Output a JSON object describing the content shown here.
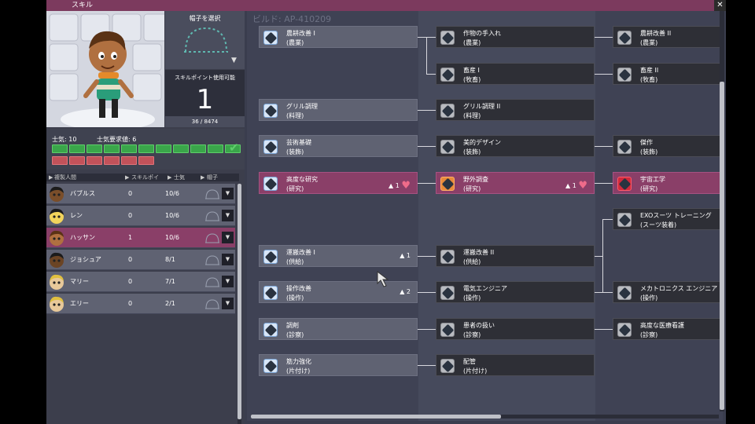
{
  "window": {
    "title": "スキル",
    "close_icon": "✕"
  },
  "hat_select": {
    "label": "帽子を選択",
    "arrow": "▼"
  },
  "skill_points": {
    "label": "スキルポイント使用可能",
    "value": "1",
    "xp": "36 / 8474"
  },
  "morale": {
    "current_label": "士気: 10",
    "required_label": "士気要求値: 6",
    "filled": 11,
    "required": 6,
    "check": "✔"
  },
  "roster": {
    "headers": {
      "name": "複製人間",
      "points": "スキルポイ",
      "morale": "士気",
      "hat": "帽子"
    },
    "rows": [
      {
        "name": "バブルス",
        "points": "0",
        "morale": "10/6",
        "selected": false,
        "skin": "#7a4e2a",
        "hair": "#1b1b1b"
      },
      {
        "name": "レン",
        "points": "0",
        "morale": "10/6",
        "selected": false,
        "skin": "#f2d45c",
        "hair": "#1b1b1b"
      },
      {
        "name": "ハッサン",
        "points": "1",
        "morale": "10/6",
        "selected": true,
        "skin": "#b07040",
        "hair": "#5a3215"
      },
      {
        "name": "ジョシュア",
        "points": "0",
        "morale": "8/1",
        "selected": false,
        "skin": "#6b4424",
        "hair": "#1b1b1b"
      },
      {
        "name": "マリー",
        "points": "0",
        "morale": "7/1",
        "selected": false,
        "skin": "#e8c99a",
        "hair": "#e0c040"
      },
      {
        "name": "エリー",
        "points": "0",
        "morale": "2/1",
        "selected": false,
        "skin": "#e8c99a",
        "hair": "#e0c040"
      }
    ],
    "dropdown_icon": "▼"
  },
  "tree": {
    "build_label": "ビルド: AP-410209",
    "col1": [
      {
        "name": "農耕改善 I",
        "cat": "(農業)",
        "style": "light",
        "icon": "blue",
        "stat": ""
      },
      {
        "name": "グリル調理",
        "cat": "(料理)",
        "style": "light",
        "icon": "blue",
        "stat": ""
      },
      {
        "name": "芸術基礎",
        "cat": "(装飾)",
        "style": "light",
        "icon": "blue",
        "stat": ""
      },
      {
        "name": "高度な研究",
        "cat": "(研究)",
        "style": "sel",
        "icon": "blue",
        "stat": "1",
        "heart": true
      },
      {
        "name": "運搬改善 I",
        "cat": "(供給)",
        "style": "light",
        "icon": "blue",
        "stat": "1"
      },
      {
        "name": "操作改善",
        "cat": "(操作)",
        "style": "light",
        "icon": "blue",
        "stat": "2"
      },
      {
        "name": "調剤",
        "cat": "(診察)",
        "style": "light",
        "icon": "blue",
        "stat": ""
      },
      {
        "name": "筋力強化",
        "cat": "(片付け)",
        "style": "light",
        "icon": "blue",
        "stat": ""
      }
    ],
    "col2": [
      {
        "name": "作物の手入れ",
        "cat": "(農業)",
        "style": "dark",
        "icon": "gray",
        "stat": ""
      },
      {
        "name": "畜産 I",
        "cat": "(牧畜)",
        "style": "dark",
        "icon": "gray",
        "stat": ""
      },
      {
        "name": "グリル調理 II",
        "cat": "(料理)",
        "style": "dark",
        "icon": "gray",
        "stat": ""
      },
      {
        "name": "美的デザイン",
        "cat": "(装飾)",
        "style": "dark",
        "icon": "gray",
        "stat": ""
      },
      {
        "name": "野外調査",
        "cat": "(研究)",
        "style": "sel",
        "icon": "orange",
        "stat": "1",
        "heart": true
      },
      {
        "name": "運搬改善 II",
        "cat": "(供給)",
        "style": "dark",
        "icon": "gray",
        "stat": ""
      },
      {
        "name": "電気エンジニア",
        "cat": "(操作)",
        "style": "dark",
        "icon": "gray",
        "stat": ""
      },
      {
        "name": "患者の扱い",
        "cat": "(診察)",
        "style": "dark",
        "icon": "gray",
        "stat": ""
      },
      {
        "name": "配管",
        "cat": "(片付け)",
        "style": "dark",
        "icon": "gray",
        "stat": ""
      }
    ],
    "col3": [
      {
        "name": "農耕改善 II",
        "cat": "(農業)",
        "style": "dark",
        "icon": "gray",
        "stat": ""
      },
      {
        "name": "畜産 II",
        "cat": "(牧畜)",
        "style": "dark",
        "icon": "gray",
        "stat": ""
      },
      {
        "name": "傑作",
        "cat": "(装飾)",
        "style": "dark",
        "icon": "gray",
        "stat": ""
      },
      {
        "name": "宇宙工学",
        "cat": "(研究)",
        "style": "sel",
        "icon": "red",
        "stat": ""
      },
      {
        "name": "EXOスーツ トレーニング",
        "cat": "(スーツ装着)",
        "style": "dark",
        "icon": "gray",
        "stat": ""
      },
      {
        "name": "メカトロニクス エンジニア",
        "cat": "(操作)",
        "style": "dark",
        "icon": "gray",
        "stat": ""
      },
      {
        "name": "高度な医療看護",
        "cat": "(診察)",
        "style": "dark",
        "icon": "gray",
        "stat": ""
      }
    ]
  }
}
